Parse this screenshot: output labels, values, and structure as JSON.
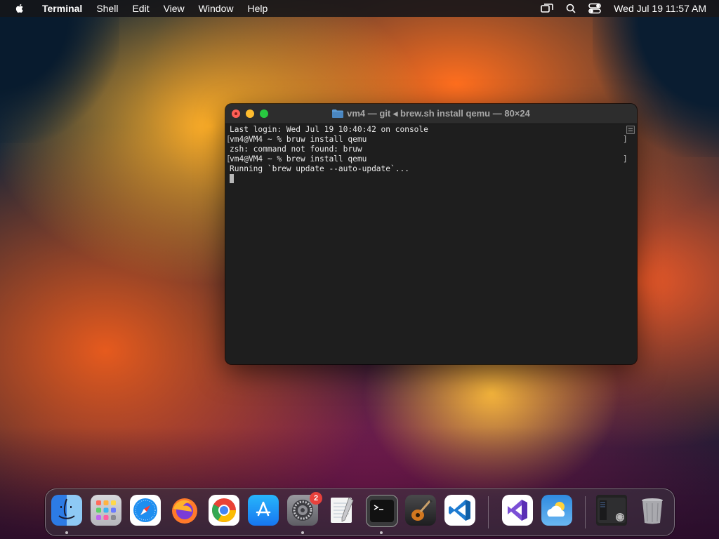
{
  "menubar": {
    "app_name": "Terminal",
    "menus": [
      "Shell",
      "Edit",
      "View",
      "Window",
      "Help"
    ],
    "status_icons": [
      "screen-mirroring-icon",
      "search-icon",
      "control-center-icon"
    ],
    "clock": "Wed Jul 19  11:57 AM"
  },
  "terminal": {
    "title": "vm4 — git ◂ brew.sh install qemu — 80×24",
    "lines": [
      "Last login: Wed Jul 19 10:40:42 on console",
      "vm4@VM4 ~ % bruw install qemu",
      "zsh: command not found: bruw",
      "vm4@VM4 ~ % brew install qemu",
      "Running `brew update --auto-update`..."
    ]
  },
  "dock": {
    "apps": [
      {
        "name": "Finder",
        "icon": "finder-icon",
        "running": true
      },
      {
        "name": "Launchpad",
        "icon": "launchpad-icon",
        "running": false
      },
      {
        "name": "Safari",
        "icon": "safari-icon",
        "running": false
      },
      {
        "name": "Firefox",
        "icon": "firefox-icon",
        "running": false
      },
      {
        "name": "Google Chrome",
        "icon": "chrome-icon",
        "running": false
      },
      {
        "name": "App Store",
        "icon": "app-store-icon",
        "running": false
      },
      {
        "name": "System Settings",
        "icon": "system-settings-icon",
        "running": true,
        "badge": "2"
      },
      {
        "name": "TextEdit",
        "icon": "textedit-icon",
        "running": false
      },
      {
        "name": "Terminal",
        "icon": "terminal-icon",
        "running": true
      },
      {
        "name": "GarageBand",
        "icon": "garageband-icon",
        "running": false
      },
      {
        "name": "Visual Studio Code",
        "icon": "vscode-icon",
        "running": false
      },
      {
        "name": "Visual Studio",
        "icon": "visual-studio-icon",
        "running": false
      },
      {
        "name": "Weather",
        "icon": "weather-icon",
        "running": false
      },
      {
        "name": "Downloads stack",
        "icon": "stack-icon",
        "running": false
      },
      {
        "name": "Trash",
        "icon": "trash-icon",
        "running": false
      }
    ]
  },
  "colors": {
    "terminal_bg": "#1e1e1e",
    "titlebar_bg": "#2d2d2d",
    "close": "#ff5f57",
    "minimize": "#febc2e",
    "zoom": "#28c840",
    "badge": "#e8413c"
  }
}
